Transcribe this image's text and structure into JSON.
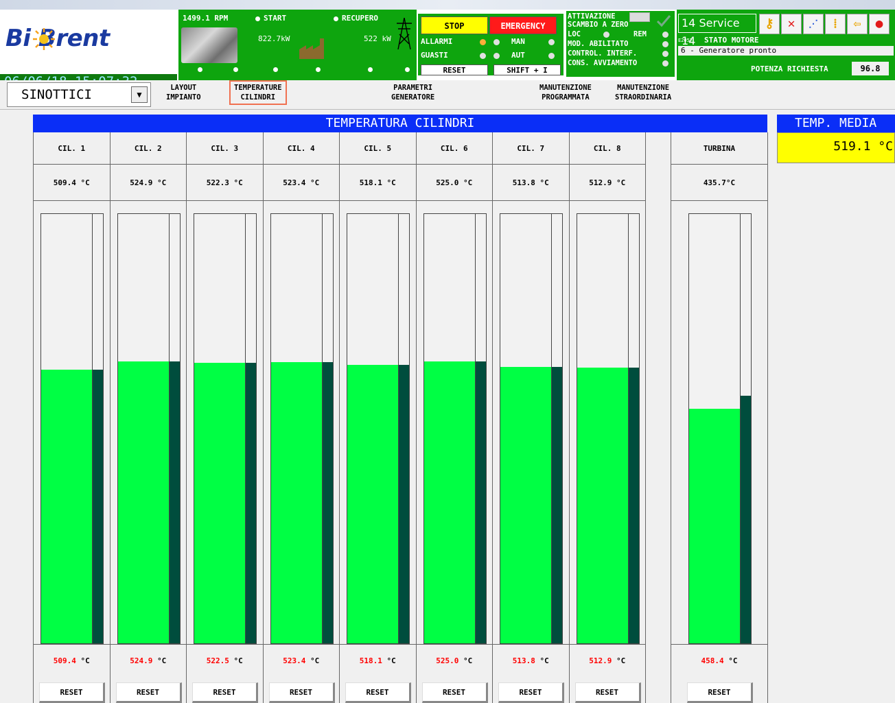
{
  "header": {
    "logo_text": "Bi Brent",
    "datetime": "06/06/18 15:07:32",
    "rpm": "1499.1 RPM",
    "start_label": "START",
    "recupero_label": "RECUPERO",
    "power_kw": "822.7kW",
    "recupero_kw": "522 kW",
    "controls": {
      "stop": "STOP",
      "emergency": "EMERGENCY",
      "allarmi": "ALLARMI",
      "guasti": "GUASTI",
      "man": "MAN",
      "aut": "AUT",
      "reset": "RESET",
      "shift": "SHIFT + I"
    },
    "activation": {
      "line1": "ATTIVAZIONE",
      "line2": "SCAMBIO A ZERO",
      "loc": "LOC",
      "rem": "REM",
      "mod": "MOD. ABILITATO",
      "control": "CONTROL. INTERF.",
      "cons": "CONS. AVVIAMENTO"
    },
    "service": "14 Service 14",
    "stato_code": "E2057",
    "stato_label": "STATO MOTORE",
    "stato_value": "6 - Generatore pronto",
    "potenza_label": "POTENZA RICHIESTA",
    "potenza_value": "96.8"
  },
  "nav": {
    "dropdown": "SINOTTICI",
    "items": [
      {
        "line1": "LAYOUT",
        "line2": "IMPIANTO"
      },
      {
        "line1": "TEMPERATURE",
        "line2": "CILINDRI"
      },
      {
        "line1": "PARAMETRI",
        "line2": "GENERATORE"
      },
      {
        "line1": "MANUTENZIONE",
        "line2": "PROGRAMMATA"
      },
      {
        "line1": "MANUTENZIONE",
        "line2": "STRAORDINARIA"
      }
    ]
  },
  "main": {
    "title": "TEMPERATURA CILINDRI",
    "reset_label": "RESET",
    "unit": "°C",
    "columns": [
      {
        "name": "CIL. 1",
        "value": "509.4 °C",
        "max": "509.4",
        "level": 0.637,
        "side_level": 0.637
      },
      {
        "name": "CIL. 2",
        "value": "524.9 °C",
        "max": "524.9",
        "level": 0.656,
        "side_level": 0.656
      },
      {
        "name": "CIL. 3",
        "value": "522.3 °C",
        "max": "522.5",
        "level": 0.653,
        "side_level": 0.653
      },
      {
        "name": "CIL. 4",
        "value": "523.4 °C",
        "max": "523.4",
        "level": 0.655,
        "side_level": 0.655
      },
      {
        "name": "CIL. 5",
        "value": "518.1 °C",
        "max": "518.1",
        "level": 0.649,
        "side_level": 0.649
      },
      {
        "name": "CIL. 6",
        "value": "525.0 °C",
        "max": "525.0",
        "level": 0.657,
        "side_level": 0.657
      },
      {
        "name": "CIL. 7",
        "value": "513.8 °C",
        "max": "513.8",
        "level": 0.644,
        "side_level": 0.644
      },
      {
        "name": "CIL. 8",
        "value": "512.9 °C",
        "max": "512.9",
        "level": 0.642,
        "side_level": 0.642
      }
    ],
    "turbina": {
      "name": "TURBINA",
      "value": "435.7°C",
      "max": "458.4",
      "level": 0.547,
      "side_level": 0.576
    }
  },
  "side": {
    "temp_media_title": "TEMP. MEDIA",
    "temp_media_value": "519.1 °C"
  },
  "colors": {
    "bar_fill": "#00ff44",
    "bar_side": "#004d3d",
    "title_blue": "#0a2ef7",
    "header_green": "#0ea50e",
    "max_red": "#ff0000"
  }
}
